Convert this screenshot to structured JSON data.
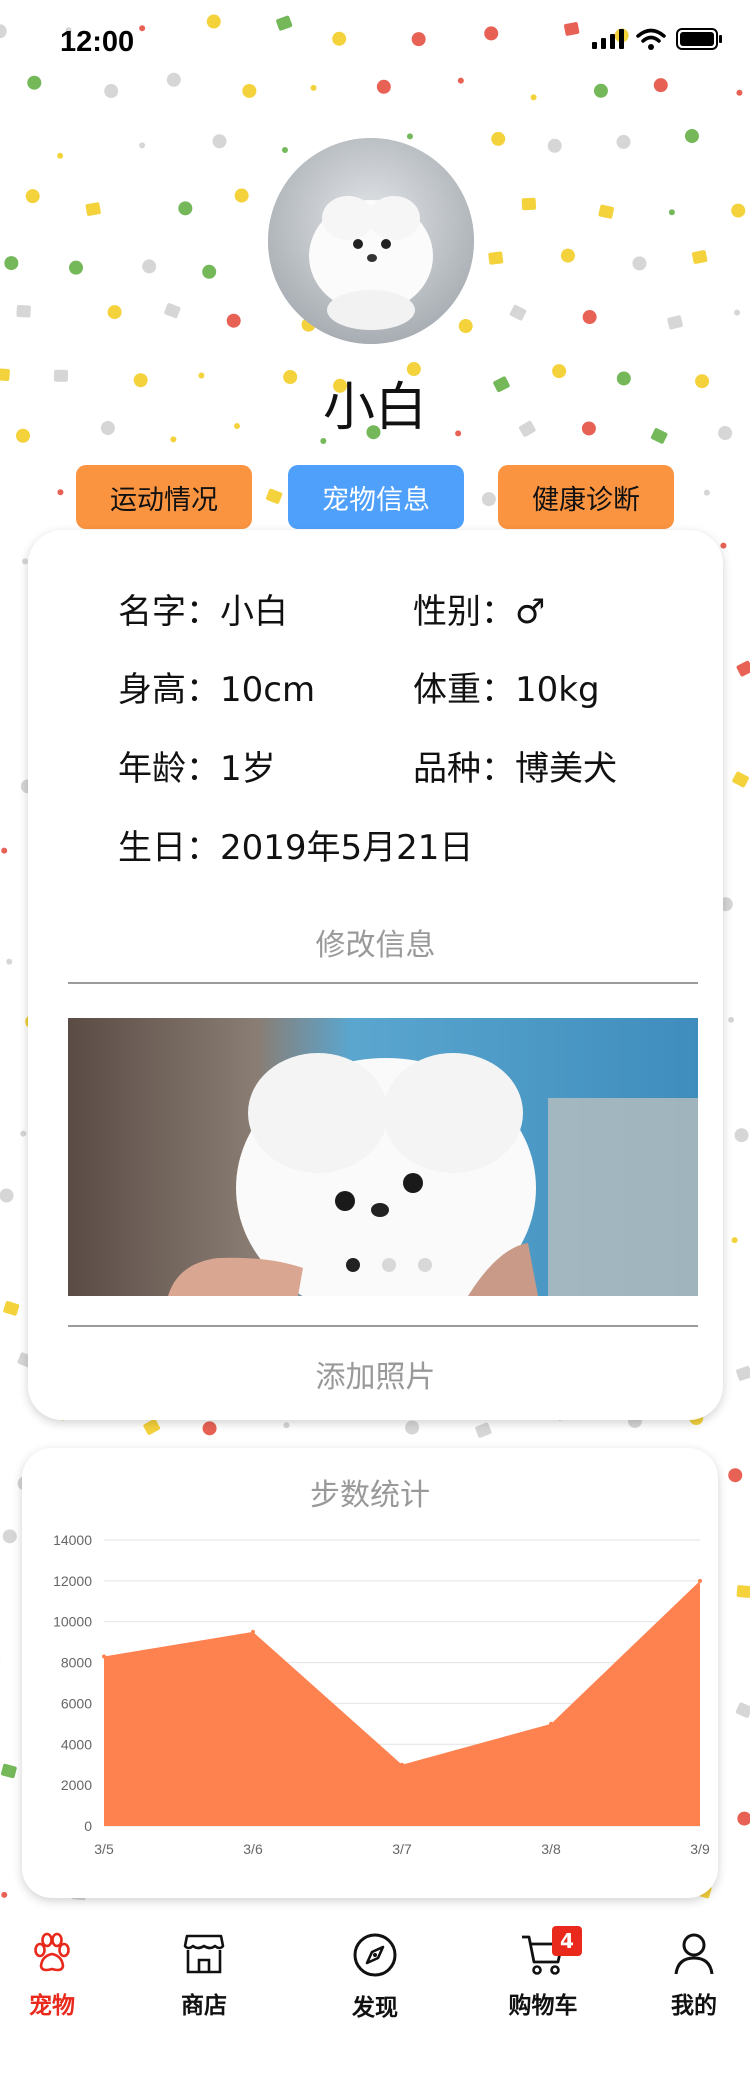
{
  "status_bar": {
    "time": "12:00"
  },
  "pet": {
    "name": "小白"
  },
  "tabs": [
    {
      "label": "运动情况",
      "active": false
    },
    {
      "label": "宠物信息",
      "active": true
    },
    {
      "label": "健康诊断",
      "active": false
    }
  ],
  "info": {
    "name_label": "名字：",
    "name_value": "小白",
    "gender_label": "性别：",
    "gender_value": "♂",
    "height_label": "身高：",
    "height_value": "10cm",
    "weight_label": "体重：",
    "weight_value": "10kg",
    "age_label": "年龄：",
    "age_value": "1岁",
    "breed_label": "品种：",
    "breed_value": "博美犬",
    "birthday_label": "生日：",
    "birthday_value": "2019年5月21日",
    "edit_label": "修改信息",
    "add_photo_label": "添加照片",
    "carousel": {
      "count": 3,
      "active_index": 0
    }
  },
  "chart_data": {
    "type": "area",
    "title": "步数统计",
    "categories": [
      "3/5",
      "3/6",
      "3/7",
      "3/8",
      "3/9"
    ],
    "values": [
      8300,
      9500,
      3000,
      5000,
      12000
    ],
    "ylim": [
      0,
      14000
    ],
    "yticks": [
      0,
      2000,
      4000,
      6000,
      8000,
      10000,
      12000,
      14000
    ],
    "grid": true,
    "fill_color": "#fe8150"
  },
  "nav": [
    {
      "label": "宠物",
      "icon": "paw-icon",
      "active": true
    },
    {
      "label": "商店",
      "icon": "store-icon",
      "active": false
    },
    {
      "label": "发现",
      "icon": "compass-icon",
      "active": false
    },
    {
      "label": "购物车",
      "icon": "cart-icon",
      "active": false,
      "badge": "4"
    },
    {
      "label": "我的",
      "icon": "user-icon",
      "active": false
    }
  ],
  "colors": {
    "accent_red": "#e8291c",
    "tab_orange": "#fb9440",
    "tab_blue": "#4fa0fb"
  }
}
